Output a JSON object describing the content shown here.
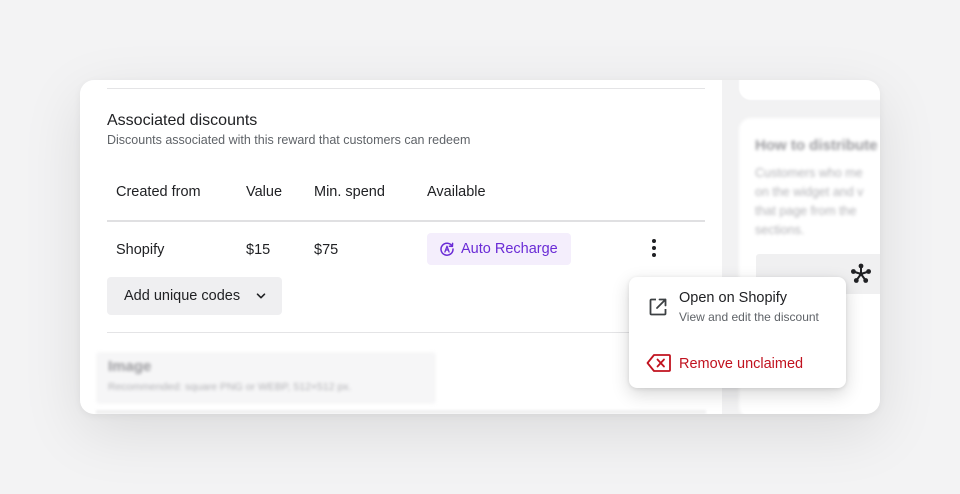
{
  "discounts": {
    "title": "Associated discounts",
    "description": "Discounts associated with this reward that customers can redeem",
    "columns": [
      "Created from",
      "Value",
      "Min. spend",
      "Available"
    ],
    "rows": [
      {
        "created_from": "Shopify",
        "value": "$15",
        "min_spend": "$75",
        "available": "Auto Recharge"
      }
    ],
    "add_button_label": "Add unique codes"
  },
  "image_section": {
    "title": "Image",
    "hint": "Recommended: square PNG or WEBP, 512×512 px."
  },
  "side_panel": {
    "title": "How to distribute",
    "text": "Customers who me\non the widget and v\nthat page from the\nsections."
  },
  "context_menu": {
    "open": {
      "label": "Open on Shopify",
      "description": "View and edit the discount"
    },
    "remove": {
      "label": "Remove unclaimed"
    }
  },
  "colors": {
    "accent_purple": "#6a2bd6",
    "badge_bg": "#f4eefc",
    "danger_red": "#c1121f"
  },
  "icons": {
    "badge": "auto-recharge-icon",
    "row_menu": "kebab-menu-icon",
    "add_codes": "chevron-down-icon",
    "open": "external-link-icon",
    "remove": "remove-tag-icon",
    "side": "widget-icon"
  }
}
